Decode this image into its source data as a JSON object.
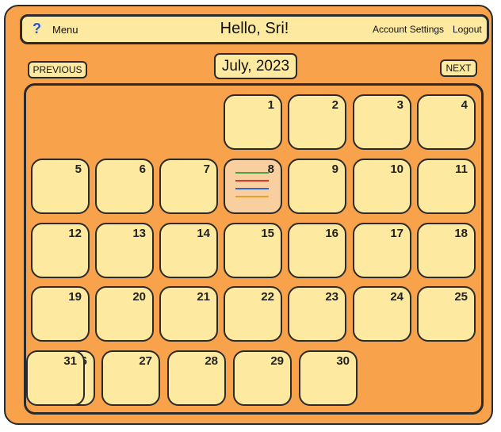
{
  "header": {
    "help_icon": "?",
    "menu_label": "Menu",
    "greeting": "Hello, Sri!",
    "account_settings": "Account Settings",
    "logout": "Logout"
  },
  "nav": {
    "previous_label": "PREVIOUS",
    "next_label": "NEXT",
    "month_title": "July, 2023"
  },
  "calendar": {
    "selected_day": 8,
    "days": [
      "1",
      "2",
      "3",
      "4",
      "5",
      "6",
      "7",
      "8",
      "9",
      "10",
      "11",
      "12",
      "13",
      "14",
      "15",
      "16",
      "17",
      "18",
      "19",
      "20",
      "21",
      "22",
      "23",
      "24",
      "25",
      "26",
      "27",
      "28",
      "29",
      "30",
      "31"
    ],
    "event_colors": [
      "#4aa04a",
      "#d23a2a",
      "#2f63d6",
      "#e8a12a"
    ]
  },
  "colors": {
    "background": "#f8a24b",
    "cell": "#fde9a0",
    "selected_cell": "#f9cfa0",
    "border": "#2a2a2a"
  }
}
